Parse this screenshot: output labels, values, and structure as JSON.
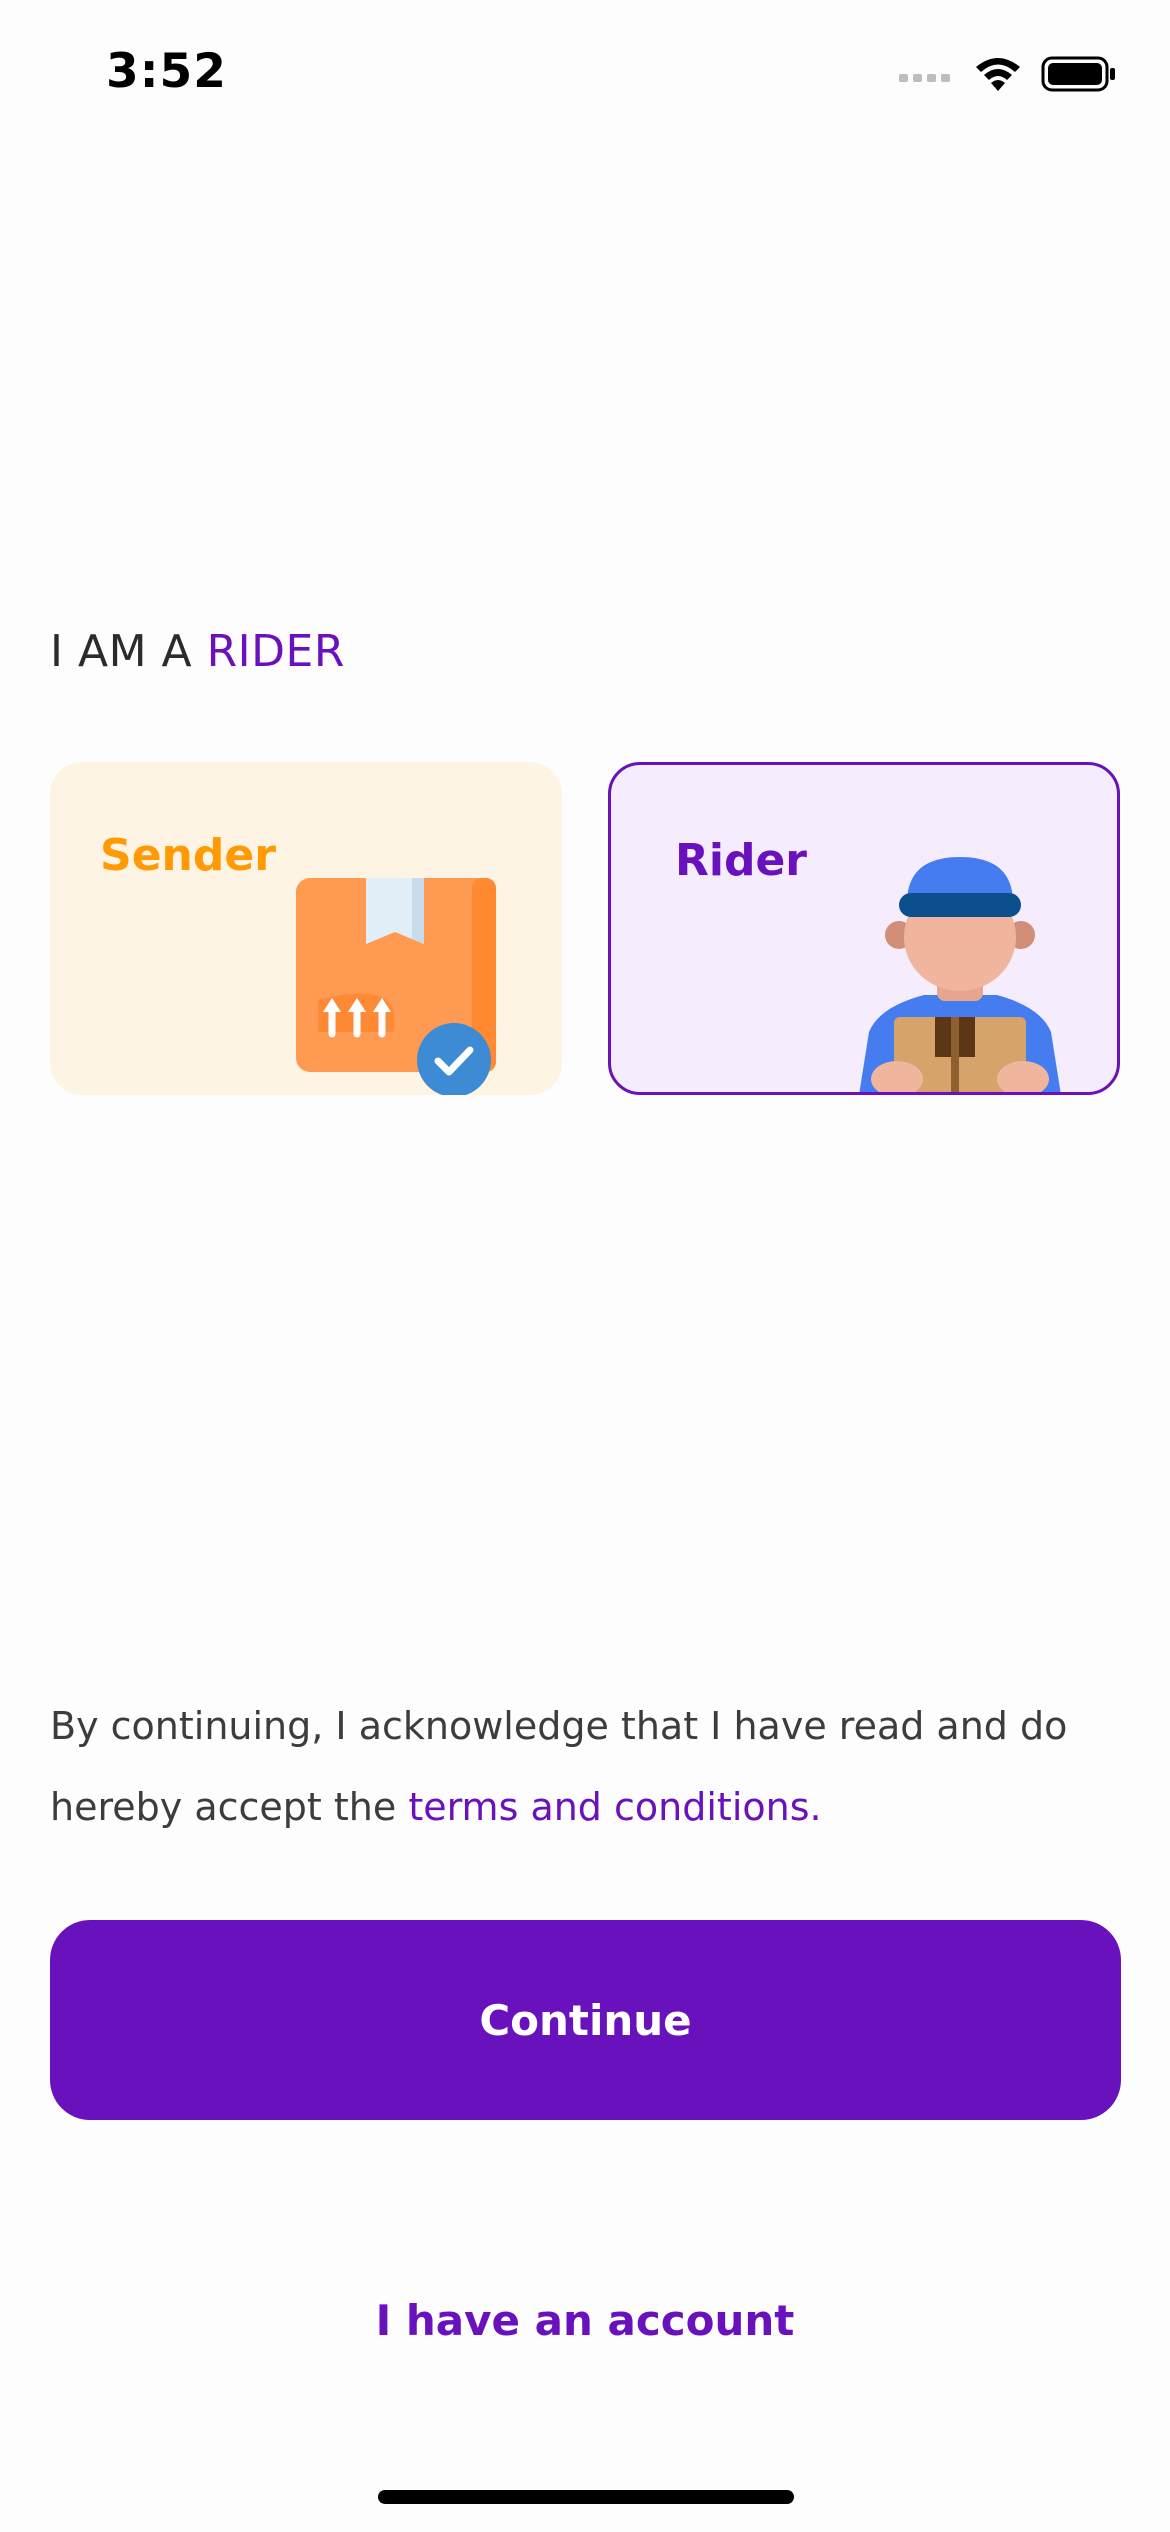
{
  "status_bar": {
    "time": "3:52"
  },
  "role_heading": {
    "prefix": "I AM A ",
    "selected_role": "RIDER"
  },
  "cards": {
    "sender": {
      "label": "Sender",
      "selected": false
    },
    "rider": {
      "label": "Rider",
      "selected": true
    }
  },
  "terms": {
    "text": "By continuing, I acknowledge that I have read and do hereby accept the ",
    "link": "terms and conditions."
  },
  "actions": {
    "continue_label": "Continue",
    "account_label": "I have an account"
  },
  "colors": {
    "accent": "#6A11BE",
    "sender_accent": "#FF9A05",
    "sender_card_bg": "#FEF4E4",
    "rider_card_bg": "#F5ECFD"
  },
  "icons": [
    "signal-icon",
    "wifi-icon",
    "battery-icon",
    "package-icon",
    "checkmark-badge-icon",
    "delivery-rider-icon"
  ]
}
